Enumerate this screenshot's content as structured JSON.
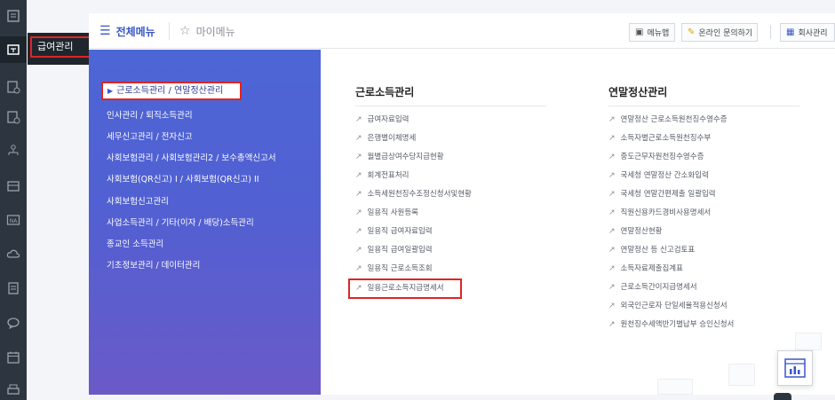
{
  "rail": {
    "icons": [
      "document-icon",
      "payroll-icon",
      "report-icon",
      "report-settings-icon",
      "people-tree-icon",
      "ledger-icon",
      "na-icon",
      "cloud-icon",
      "doc-list-icon",
      "chat-icon",
      "calendar-icon",
      "printer-icon"
    ]
  },
  "flyout": {
    "label": "급여관리"
  },
  "topbar": {
    "all_menu": "전체메뉴",
    "my_menu": "마이메뉴",
    "menu_btn": "메뉴맵",
    "inquiry_btn": "온라인 문의하기",
    "company_btn": "회사관리"
  },
  "categories": {
    "active": "근로소득관리 / 연말정산관리",
    "items": [
      "인사관리 / 퇴직소득관리",
      "세무신고관리 / 전자신고",
      "사회보험관리 / 사회보험관리2 / 보수총액신고서",
      "사회보험(QR신고) I  / 사회보험(QR신고) II",
      "사회보험신고관리",
      "사업소득관리 / 기타(이자 / 배당)소득관리",
      "종교인 소득관리",
      "기초정보관리 / 데이터관리"
    ]
  },
  "col1": {
    "title": "근로소득관리",
    "items": [
      "급여자료입력",
      "은행별이체명세",
      "월별급상여수당지급현황",
      "회계전표처리",
      "소득세원천징수조정신청서및현황",
      "일용직 사원등록",
      "일용직 급여자료입력",
      "일용직 급여일괄입력",
      "일용직 근로소득조회",
      "일용근로소득지급명세서"
    ]
  },
  "col2": {
    "title": "연말정산관리",
    "items": [
      "연말정산 근로소득원천징수영수증",
      "소득자별근로소득원천징수부",
      "중도근무자원천징수영수증",
      "국세청 연말정산 간소화입력",
      "국세청 연말간편제출 일괄입력",
      "직원신용카드경비사용명세서",
      "연말정산현황",
      "연말정산 등 신고검토표",
      "소득자료제출집계표",
      "근로소득간이지급명세서",
      "외국인근로자 단일세율적용신청서",
      "원천징수세액반기별납부 승인신청서"
    ]
  }
}
